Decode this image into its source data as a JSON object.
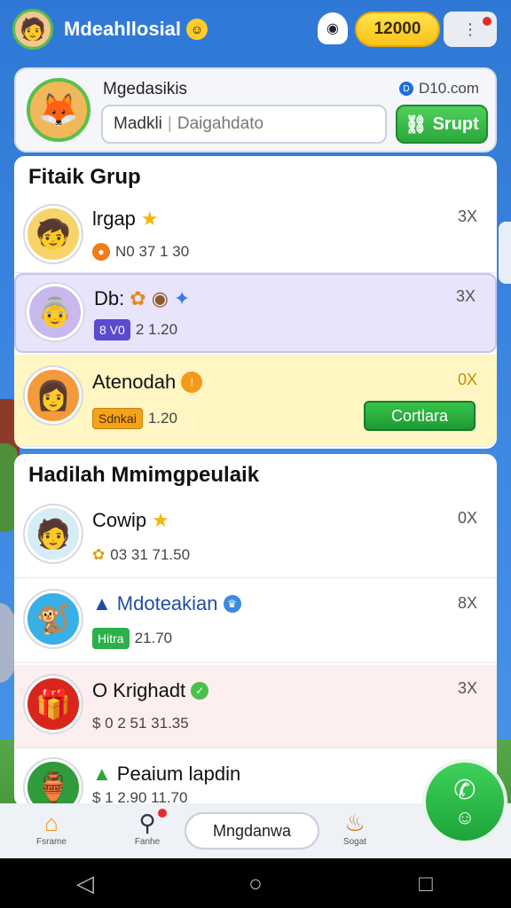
{
  "header": {
    "app_title": "Mdeahllosial",
    "coin_amount": "12000",
    "avatar_icon": "boy-avatar-icon"
  },
  "profile": {
    "name": "Mgedasikis",
    "link_text": "D10.com",
    "search_value": "Madkli",
    "search_placeholder": "Daigahdato",
    "action_label": "Srupt"
  },
  "section1": {
    "title": "Fitaik Grup",
    "rows": [
      {
        "name": "lrgap",
        "meta": "N0 37 1 30",
        "mult": "3X",
        "bg": "white"
      },
      {
        "name": "Db:",
        "badge": "8 V0",
        "meta": "2 1.20",
        "mult": "3X",
        "bg": "purple"
      },
      {
        "name": "Atenodah",
        "badge": "Sdnkai",
        "meta": "1.20",
        "mult": "0X",
        "bg": "yellow",
        "action": "Cortlara"
      }
    ]
  },
  "section2": {
    "title": "Hadilah Mmimgpeulaik",
    "rows": [
      {
        "name": "Cowip",
        "meta": "03 31 71.50",
        "mult": "0X"
      },
      {
        "name": "Mdoteakian",
        "badge": "Hitra",
        "meta": "21.70",
        "mult": "8X"
      },
      {
        "name": "O Krighadt",
        "meta": "$ 0 2 51 31.35",
        "mult": "3X"
      },
      {
        "name": "Peaium lapdin",
        "meta": "$ 1 2.90 11.70",
        "mult": ""
      }
    ]
  },
  "nav": {
    "home_label": "Fsrame",
    "search_label": "Fanhe",
    "center_label": "Mngdanwa",
    "shop_label": "Sogat"
  },
  "colors": {
    "accent_green": "#2aa83a",
    "coin_yellow": "#f8c21a",
    "background_blue": "#3b86e0"
  }
}
